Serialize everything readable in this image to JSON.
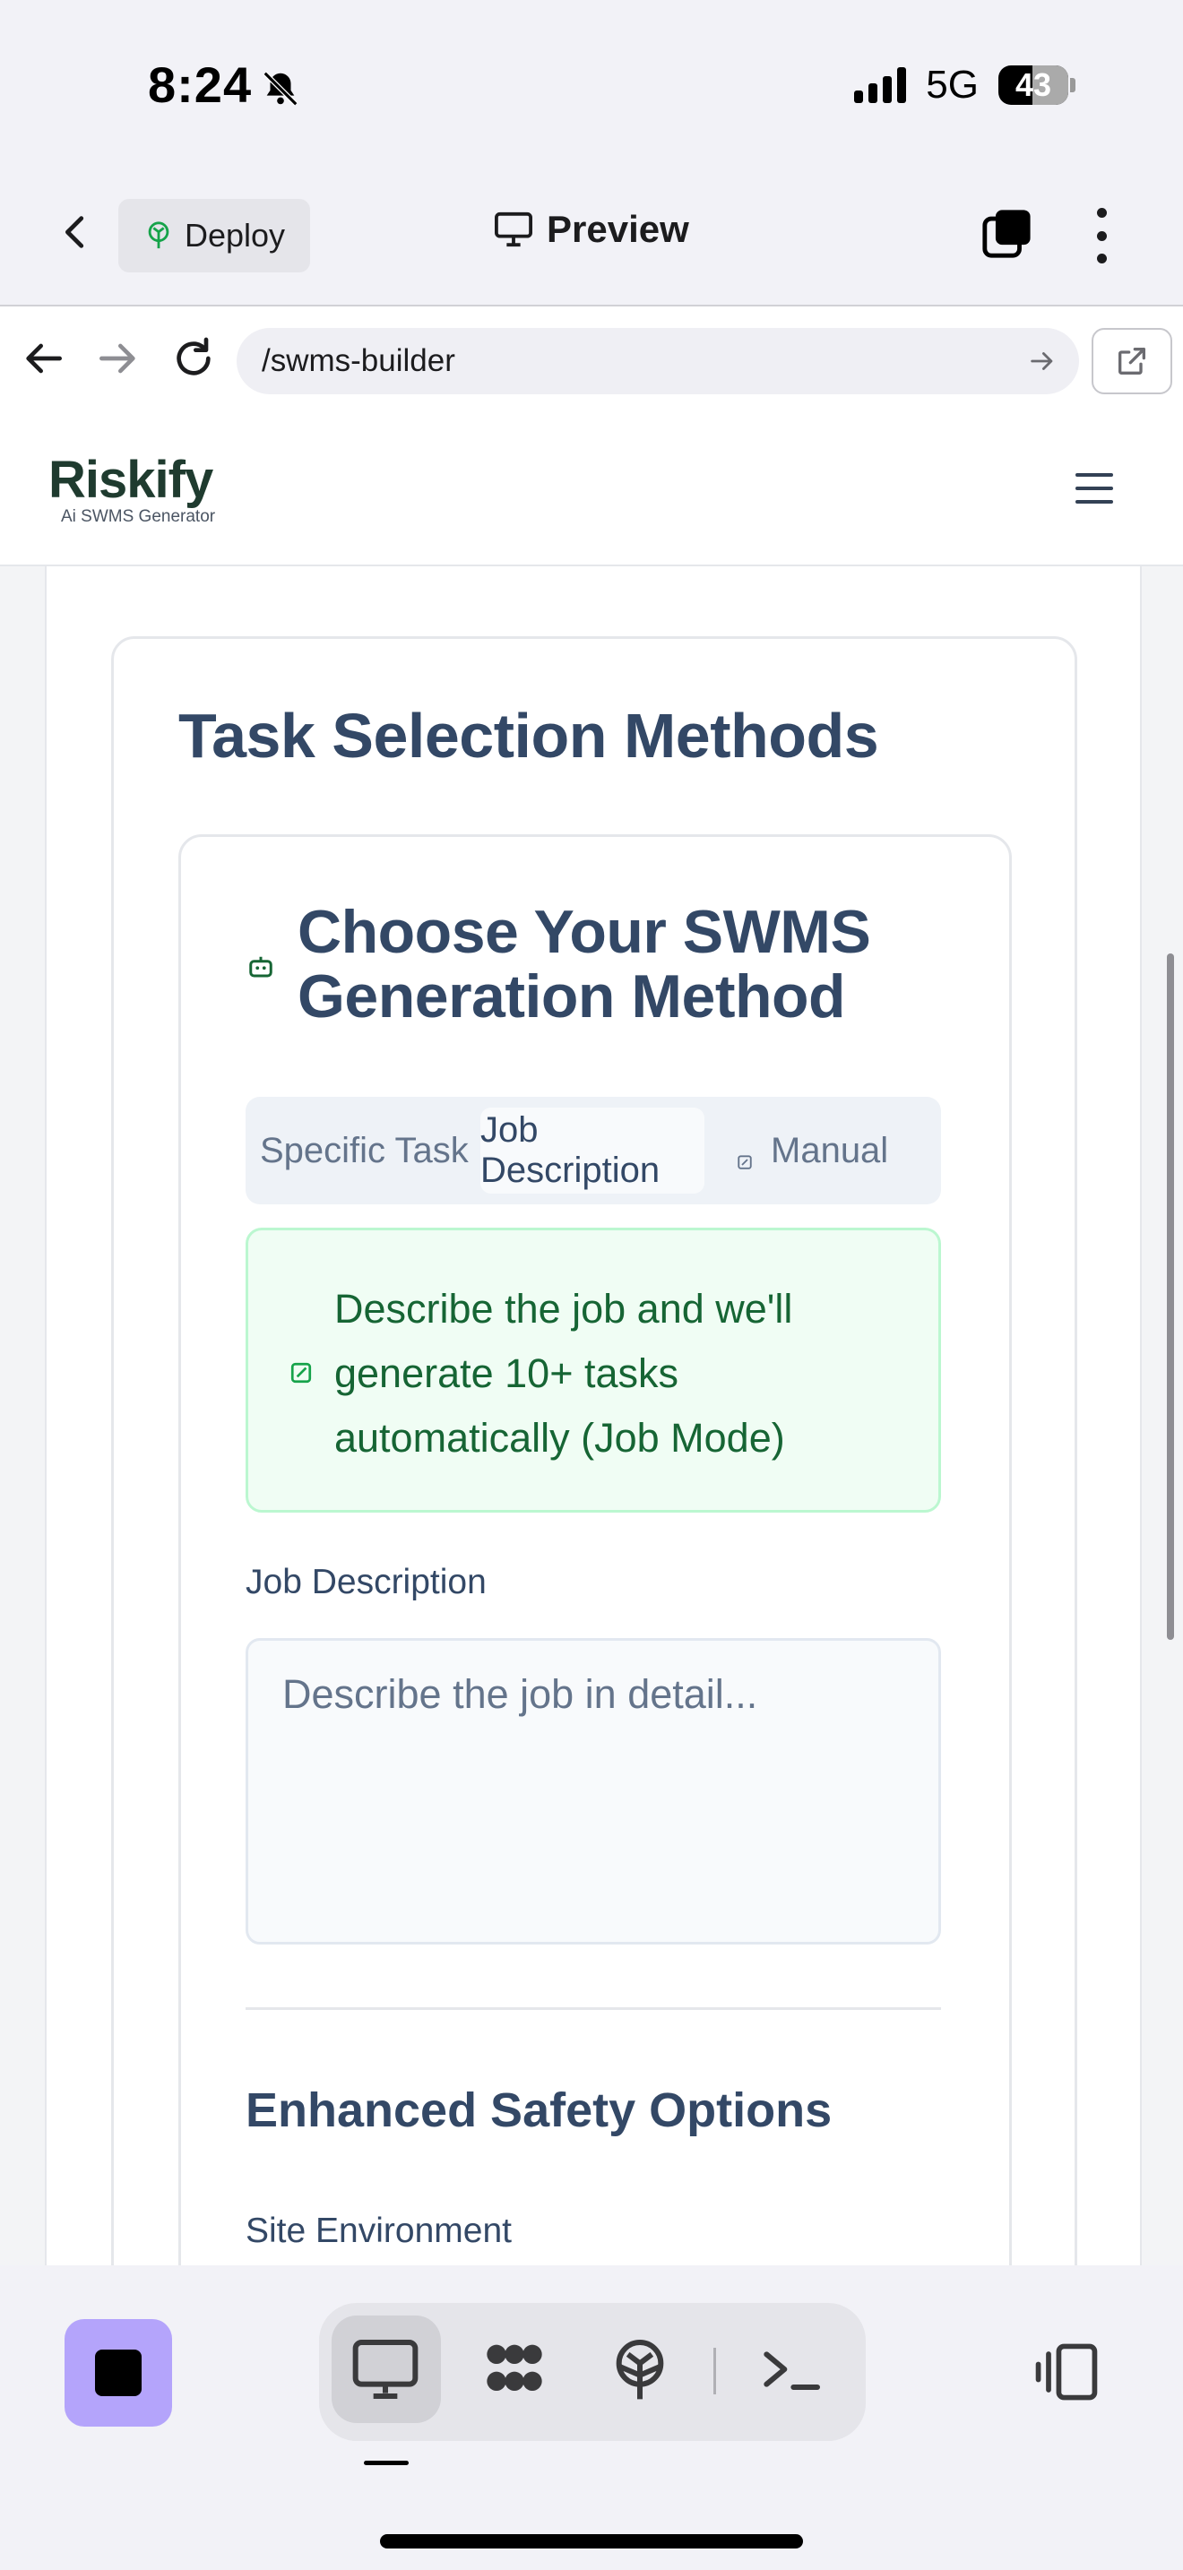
{
  "status_bar": {
    "time": "8:24",
    "network": "5G",
    "battery": "43",
    "icons": [
      "bell-slash-icon",
      "signal-icon",
      "battery-icon"
    ]
  },
  "ide_header": {
    "deploy_label": "Deploy",
    "preview_label": "Preview"
  },
  "browser": {
    "url": "/swms-builder"
  },
  "site": {
    "logo": {
      "name": "Riskify",
      "tagline": "Ai SWMS Generator"
    },
    "section_title": "Task Selection Methods",
    "method_title": "Choose Your SWMS Generation Method",
    "tabs": [
      {
        "label": "Specific Task",
        "active": false
      },
      {
        "label": "Job Description",
        "active": true
      },
      {
        "label": "Manual",
        "active": false
      }
    ],
    "info_text": "Describe the job and we'll generate 10+ tasks automatically (Job Mode)",
    "job_description_label": "Job Description",
    "job_description_placeholder": "Describe the job in detail...",
    "safety_title": "Enhanced Safety Options",
    "site_environment_label": "Site Environment"
  },
  "colors": {
    "accent_green": "#166534",
    "heading": "#334866",
    "stop_button": "#b4a4fb"
  }
}
